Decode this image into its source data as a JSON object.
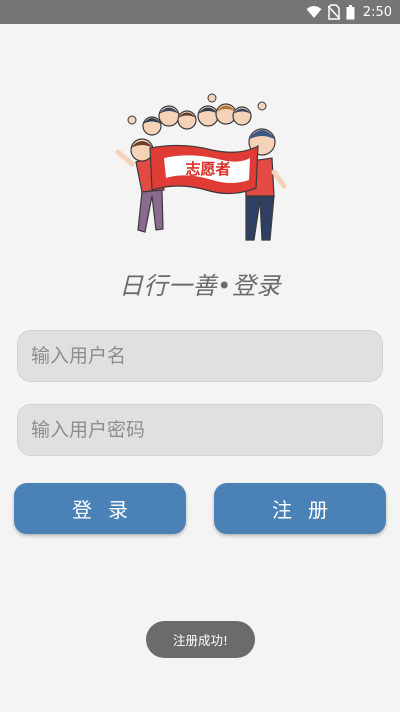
{
  "status_bar": {
    "time": "2:50",
    "icons": [
      "wifi-icon",
      "no-sim-icon",
      "battery-icon"
    ]
  },
  "hero": {
    "banner_text": "志愿者"
  },
  "title": "日行一善•登录",
  "form": {
    "username_placeholder": "输入用户名",
    "password_placeholder": "输入用户密码"
  },
  "buttons": {
    "login_label": "登录",
    "register_label": "注册"
  },
  "toast": {
    "message": "注册成功!"
  },
  "colors": {
    "button_blue": "#4a82b8",
    "status_bar": "#757575",
    "banner_red": "#e03b35",
    "background": "#f4f4f4"
  }
}
